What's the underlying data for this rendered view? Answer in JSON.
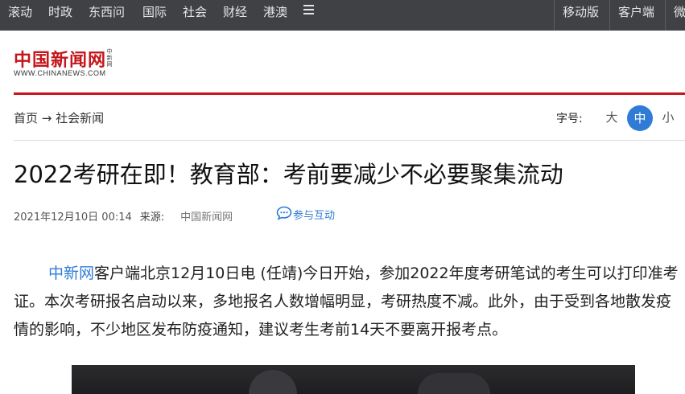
{
  "topnav": {
    "left_items": [
      "滚动",
      "时政",
      "东西问",
      "国际",
      "社会",
      "财经",
      "港澳"
    ],
    "menu_icon": "hamburger-icon",
    "right_items": [
      "移动版",
      "客户端",
      "微"
    ]
  },
  "logo": {
    "title": "中国新闻网",
    "side_text": "中新网",
    "url": "WWW.CHINANEWS.COM"
  },
  "breadcrumb": {
    "home": "首页",
    "arrow": "→",
    "section": "社会新闻"
  },
  "font_size": {
    "label": "字号:",
    "options": [
      "大",
      "中",
      "小"
    ],
    "selected": "中"
  },
  "article": {
    "title": "2022考研在即！教育部：考前要减少不必要聚集流动",
    "datetime": "2021年12月10日 00:14",
    "source_label": "来源:",
    "source": "中国新闻网",
    "interact_label": "参与互动",
    "lead_link": "中新网",
    "body": "客户端北京12月10日电 (任靖)今日开始，参加2022年度考研笔试的考生可以打印准考证。本次考研报名启动以来，多地报名人数增幅明显，考研热度不减。此外，由于受到各地散发疫情的影响，不少地区发布防疫通知，建议考生考前14天不要离开报考点。"
  },
  "colors": {
    "brand_red": "#c4161c",
    "link_blue": "#2f7bd6",
    "topbar_bg": "#3f4145"
  }
}
